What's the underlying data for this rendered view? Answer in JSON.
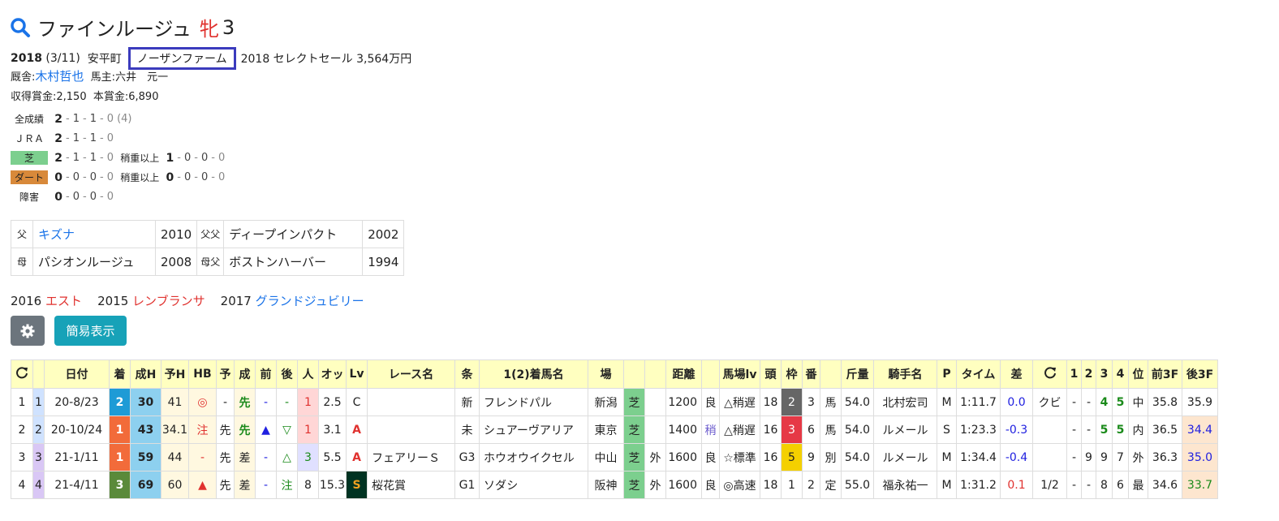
{
  "horse": {
    "name": "ファインルージュ",
    "sex": "牝",
    "age": "3"
  },
  "info": {
    "birth_year": "2018",
    "birth_date": "(3/11)",
    "region": "安平町",
    "breeder": "ノーザンファーム",
    "sale": "2018 セレクトセール 3,564万円"
  },
  "stable": {
    "trainer_label": "厩舎:",
    "trainer": "木村哲也",
    "owner_label": "馬主:",
    "owner": "六井　元一"
  },
  "prize": {
    "earned": "収得賞金:2,150",
    "main": "本賞金:6,890"
  },
  "records": [
    {
      "label": "全成績",
      "w": "2",
      "v": [
        "1",
        "1",
        "0 (4)"
      ]
    },
    {
      "label": "ＪＲＡ",
      "w": "2",
      "v": [
        "1",
        "1",
        "0"
      ]
    },
    {
      "label": "芝",
      "w": "2",
      "v": [
        "1",
        "1",
        "0"
      ],
      "sub_label": "稍重以上",
      "sub_w": "1",
      "sub_v": [
        "0",
        "0",
        "0"
      ]
    },
    {
      "label": "ダート",
      "w": "0",
      "v": [
        "0",
        "0",
        "0"
      ],
      "sub_label": "稍重以上",
      "sub_w": "0",
      "sub_v": [
        "0",
        "0",
        "0"
      ]
    },
    {
      "label": "障害",
      "w": "0",
      "v": [
        "0",
        "0",
        "0"
      ]
    }
  ],
  "pedigree": {
    "sire_label": "父",
    "sire": "キズナ",
    "sire_year": "2010",
    "sire_sire_label": "父父",
    "sire_sire": "ディープインパクト",
    "sire_sire_year": "2002",
    "dam_label": "母",
    "dam": "パシオンルージュ",
    "dam_year": "2008",
    "dam_sire_label": "母父",
    "dam_sire": "ボストンハーバー",
    "dam_sire_year": "1994"
  },
  "siblings": [
    {
      "year": "2016",
      "name": "エスト"
    },
    {
      "year": "2015",
      "name": "レンブランサ"
    },
    {
      "year": "2017",
      "name": "グランドジュビリー"
    }
  ],
  "buttons": {
    "simple": "簡易表示"
  },
  "table": {
    "headers": [
      "",
      "",
      "日付",
      "着",
      "成H",
      "予H",
      "HB",
      "予",
      "成",
      "前",
      "後",
      "人",
      "オッ",
      "Lv",
      "レース名",
      "条",
      "1(2)着馬名",
      "場",
      "",
      "",
      "距離",
      "",
      "馬場lv",
      "頭",
      "枠",
      "番",
      "",
      "斤量",
      "騎手名",
      "P",
      "タイム",
      "差",
      "",
      "1",
      "2",
      "3",
      "4",
      "位",
      "前3F",
      "後3F"
    ],
    "rows": [
      [
        "1",
        "1",
        "20-8/23",
        "2",
        "30",
        "41",
        "◎",
        "-",
        "先",
        "-",
        "-",
        "1",
        "2.5",
        "C",
        "",
        "新",
        "フレンドパル",
        "新潟",
        "芝",
        "",
        "1200",
        "良",
        "△稍遅",
        "18",
        "2",
        "3",
        "馬",
        "54.0",
        "北村宏司",
        "M",
        "1:11.7",
        "0.0",
        "クビ",
        "-",
        "-",
        "4",
        "5",
        "中",
        "35.8",
        "35.9"
      ],
      [
        "2",
        "2",
        "20-10/24",
        "1",
        "43",
        "34.1",
        "注",
        "先",
        "先",
        "▲",
        "▽",
        "1",
        "3.1",
        "A",
        "",
        "未",
        "シュアーヴアリア",
        "東京",
        "芝",
        "",
        "1400",
        "稍",
        "△稍遅",
        "16",
        "3",
        "6",
        "馬",
        "54.0",
        "ルメール",
        "S",
        "1:23.3",
        "-0.3",
        "",
        "-",
        "-",
        "5",
        "5",
        "内",
        "36.5",
        "34.4"
      ],
      [
        "3",
        "3",
        "21-1/11",
        "1",
        "59",
        "44",
        "-",
        "先",
        "差",
        "-",
        "△",
        "3",
        "5.5",
        "A",
        "フェアリーＳ",
        "G3",
        "ホウオウイクセル",
        "中山",
        "芝",
        "外",
        "1600",
        "良",
        "☆標準",
        "16",
        "5",
        "9",
        "別",
        "54.0",
        "ルメール",
        "M",
        "1:34.4",
        "-0.4",
        "",
        "-",
        "9",
        "9",
        "7",
        "外",
        "36.3",
        "35.0"
      ],
      [
        "4",
        "4",
        "21-4/11",
        "3",
        "69",
        "60",
        "▲",
        "先",
        "差",
        "-",
        "注",
        "8",
        "15.3",
        "S",
        "桜花賞",
        "G1",
        "ソダシ",
        "阪神",
        "芝",
        "外",
        "1600",
        "良",
        "◎高速",
        "18",
        "1",
        "2",
        "定",
        "55.0",
        "福永祐一",
        "M",
        "1:31.2",
        "0.1",
        "1/2",
        "-",
        "-",
        "8",
        "6",
        "最",
        "34.6",
        "33.7"
      ]
    ]
  }
}
